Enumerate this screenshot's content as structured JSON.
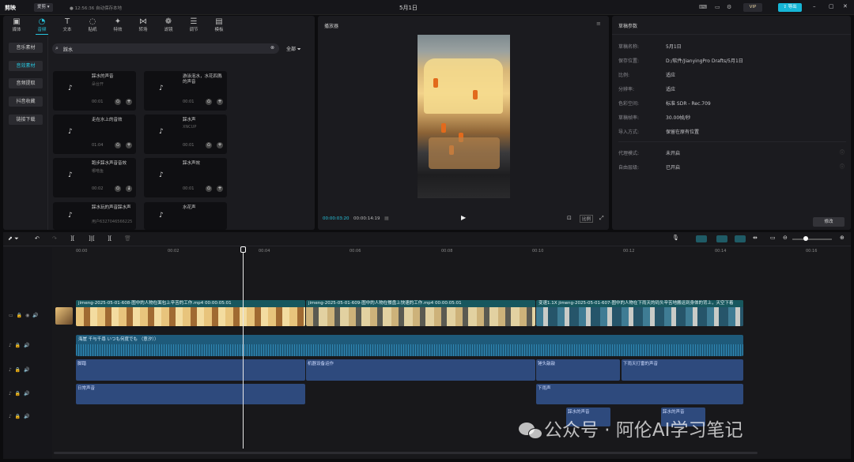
{
  "app": {
    "title": "剪映",
    "badge": "爱剪 ▾",
    "autosave": "12:56:36 自动保存本地",
    "project": "5月1日",
    "vip": "VIP",
    "export": "导出"
  },
  "toolbar": [
    "媒体",
    "音频",
    "文本",
    "贴纸",
    "特效",
    "转场",
    "滤镜",
    "调节",
    "模板"
  ],
  "sidebar": [
    "音乐素材",
    "音效素材",
    "音频提取",
    "抖音收藏",
    "链接下载"
  ],
  "search": {
    "value": "踩水",
    "filter": "全部"
  },
  "cards": [
    {
      "t1": "踩水的声音",
      "t2": "朵台开",
      "dur": "00:01",
      "b2": "+"
    },
    {
      "t1": "游泳泡水，水花四溅的声音",
      "t2": "",
      "dur": "00:01",
      "b2": "+"
    },
    {
      "t1": "走在水上的音效",
      "t2": "",
      "dur": "01:04",
      "b2": "+"
    },
    {
      "t1": "踩水声",
      "t2": "XNCUP",
      "dur": "00:01",
      "b2": "+"
    },
    {
      "t1": "跑步踩水声音音效",
      "t2": "哪嗒鱼",
      "dur": "00:02",
      "b2": "↓"
    },
    {
      "t1": "踩水声效",
      "t2": "",
      "dur": "00:01",
      "b2": "+"
    },
    {
      "t1": "踩水玩的声音踩水声",
      "t2": "用户6327046566225",
      "dur": "",
      "b2": ""
    },
    {
      "t1": "水花声",
      "t2": "",
      "dur": "",
      "b2": ""
    }
  ],
  "player": {
    "title": "播放器",
    "cur": "00:00:03:20",
    "total": "00:00:14:19",
    "ratio": "比例"
  },
  "draft": {
    "title": "草稿参数",
    "rows": [
      [
        "草稿名称:",
        "5月1日"
      ],
      [
        "保存位置:",
        "D:/软件/JianyingPro Drafts/5月1日"
      ],
      [
        "比例:",
        "适应"
      ],
      [
        "分辨率:",
        "适应"
      ],
      [
        "色彩空间:",
        "标准 SDR - Rec.709"
      ],
      [
        "草稿帧率:",
        "30.00帧/秒"
      ],
      [
        "导入方式:",
        "保留在原有位置"
      ]
    ],
    "rows2": [
      [
        "代理模式:",
        "未开启"
      ],
      [
        "自由层级:",
        "已开启"
      ]
    ],
    "edit": "修改"
  },
  "ruler": [
    "00:00",
    "00:02",
    "00:04",
    "00:06",
    "00:08",
    "00:10",
    "00:12",
    "00:14",
    "00:16"
  ],
  "video": [
    "jimeng-2025-05-01-608-图中的人物在面包上辛苦的工作.mp4   00:00:05:01",
    "jimeng-2025-05-01-609-图中的人物在餐盘上快速的工作.mp4   00:00:05:01",
    "变速1.1X   jimeng-2025-05-01-607-图中的人物在下雨天的码头辛苦地搬运到身体的背上，天空下着"
  ],
  "audio": {
    "music": "海崖 千与千尋 いつも何度でも （意汐））",
    "a1": "脚踏",
    "a2": "机器设备运作",
    "a3": "锤头敲敲",
    "a4": "下雨天打雷的声音",
    "b1": "日常声音",
    "b2": "下雨声",
    "c1": "踩水的声音",
    "c2": "踩水的声音"
  },
  "watermark": "公众号 · 阿伦AI学习笔记"
}
